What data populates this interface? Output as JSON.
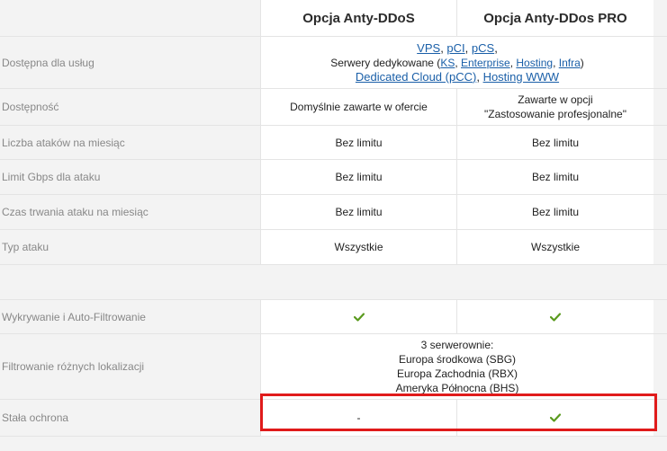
{
  "header": {
    "col_a": "Opcja Anty-DDoS",
    "col_b": "Opcja Anty-DDos PRO"
  },
  "rows": {
    "services": {
      "label": "Dostępna dla usług",
      "line1_links": [
        "VPS",
        "pCI",
        "pCS"
      ],
      "line1_sep1": ", ",
      "line1_sep2": ", ",
      "line1_end": ",",
      "line2_prefix": "Serwery dedykowane (",
      "line2_links": [
        "KS",
        "Enterprise",
        "Hosting",
        "Infra"
      ],
      "line2_sep": ", ",
      "line2_end": ")",
      "line3_links": [
        "Dedicated Cloud (pCC)",
        "Hosting WWW"
      ],
      "line3_sep": ", "
    },
    "availability": {
      "label": "Dostępność",
      "a": "Domyślnie zawarte w ofercie",
      "b_line1": "Zawarte w opcji",
      "b_line2": "\"Zastosowanie profesjonalne\""
    },
    "attacks_per_month": {
      "label": "Liczba ataków na miesiąc",
      "a": "Bez limitu",
      "b": "Bez limitu"
    },
    "gbps_limit": {
      "label": "Limit Gbps dla ataku",
      "a": "Bez limitu",
      "b": "Bez limitu"
    },
    "duration": {
      "label": "Czas trwania ataku na miesiąc",
      "a": "Bez limitu",
      "b": "Bez limitu"
    },
    "attack_type": {
      "label": "Typ ataku",
      "a": "Wszystkie",
      "b": "Wszystkie"
    },
    "detection": {
      "label": "Wykrywanie i Auto-Filtrowanie",
      "a_icon": "check-icon",
      "b_icon": "check-icon"
    },
    "filtering": {
      "label": "Filtrowanie różnych lokalizacji",
      "lines": [
        "3 serwerownie:",
        "Europa środkowa (SBG)",
        "Europa Zachodnia (RBX)",
        "Ameryka Północna (BHS)"
      ]
    },
    "constant": {
      "label": "Stała ochrona",
      "a": "-",
      "b_icon": "check-icon"
    }
  },
  "colors": {
    "check": "#5a9a1e",
    "link": "#1a5fa8",
    "highlight": "#e01b1b"
  }
}
